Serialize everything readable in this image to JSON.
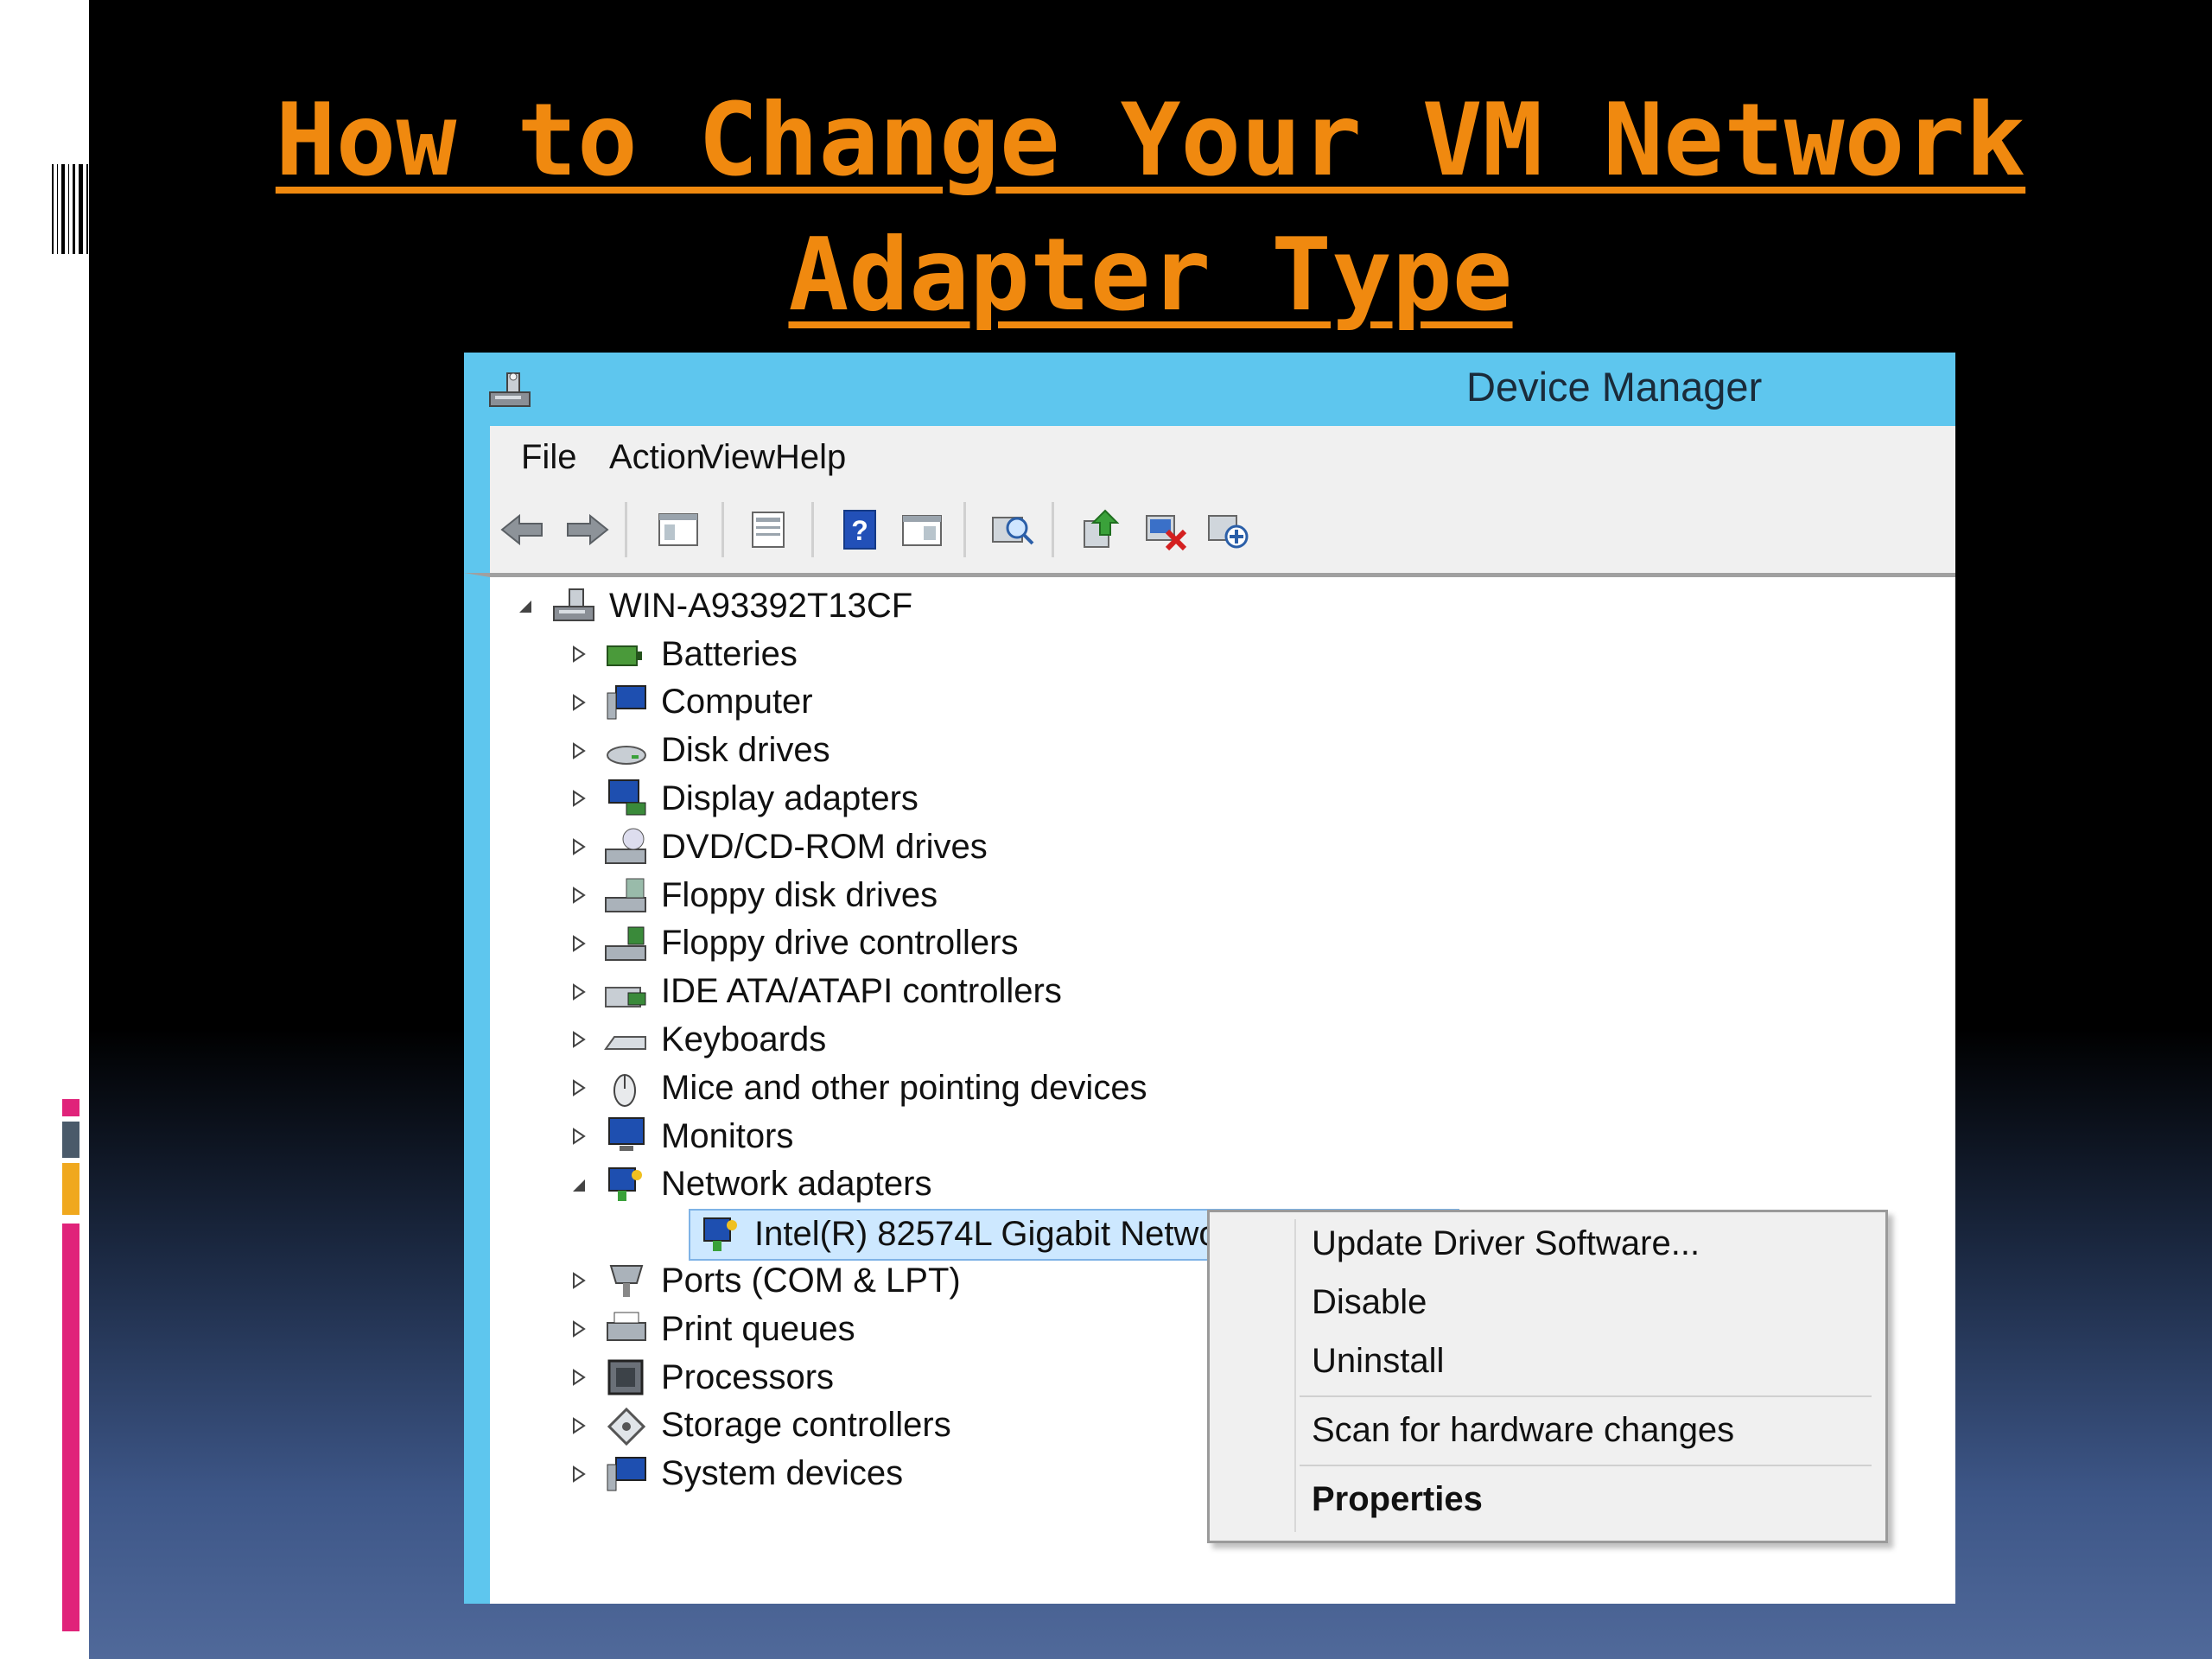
{
  "slide": {
    "title_line1": "How to Change Your VM Network",
    "title_line2": "Adapter Type"
  },
  "colors": {
    "title": "#f0890f",
    "titlebar": "#5ec6ee",
    "accent_pink": "#e0237a",
    "accent_orange": "#f0a81e",
    "accent_gray": "#4a5a6a"
  },
  "window": {
    "title": "Device Manager",
    "icon": "device-manager-icon",
    "menu": [
      "File",
      "Action",
      "View",
      "Help"
    ],
    "toolbar_icons": [
      "back-arrow-icon",
      "forward-arrow-icon",
      "show-hide-tree-icon",
      "properties-icon",
      "help-icon",
      "view-icon",
      "scan-hardware-icon",
      "update-driver-icon",
      "uninstall-icon",
      "add-legacy-icon"
    ]
  },
  "tree": {
    "root": "WIN-A93392T13CF",
    "categories": [
      {
        "label": "Batteries",
        "icon": "battery-icon"
      },
      {
        "label": "Computer",
        "icon": "computer-icon"
      },
      {
        "label": "Disk drives",
        "icon": "disk-drive-icon"
      },
      {
        "label": "Display adapters",
        "icon": "display-adapter-icon"
      },
      {
        "label": "DVD/CD-ROM drives",
        "icon": "dvd-drive-icon"
      },
      {
        "label": "Floppy disk drives",
        "icon": "floppy-drive-icon"
      },
      {
        "label": "Floppy drive controllers",
        "icon": "floppy-controller-icon"
      },
      {
        "label": "IDE ATA/ATAPI controllers",
        "icon": "ide-controller-icon"
      },
      {
        "label": "Keyboards",
        "icon": "keyboard-icon"
      },
      {
        "label": "Mice and other pointing devices",
        "icon": "mouse-icon"
      },
      {
        "label": "Monitors",
        "icon": "monitor-icon"
      },
      {
        "label": "Network adapters",
        "icon": "network-adapter-icon"
      },
      {
        "label": "Ports (COM & LPT)",
        "icon": "port-icon"
      },
      {
        "label": "Print queues",
        "icon": "printer-icon"
      },
      {
        "label": "Processors",
        "icon": "processor-icon"
      },
      {
        "label": "Storage controllers",
        "icon": "storage-controller-icon"
      },
      {
        "label": "System devices",
        "icon": "system-device-icon"
      }
    ],
    "selected_child": "Intel(R) 82574L Gigabit Network"
  },
  "context_menu": {
    "items": [
      "Update Driver Software...",
      "Disable",
      "Uninstall",
      "Scan for hardware changes",
      "Properties"
    ]
  }
}
